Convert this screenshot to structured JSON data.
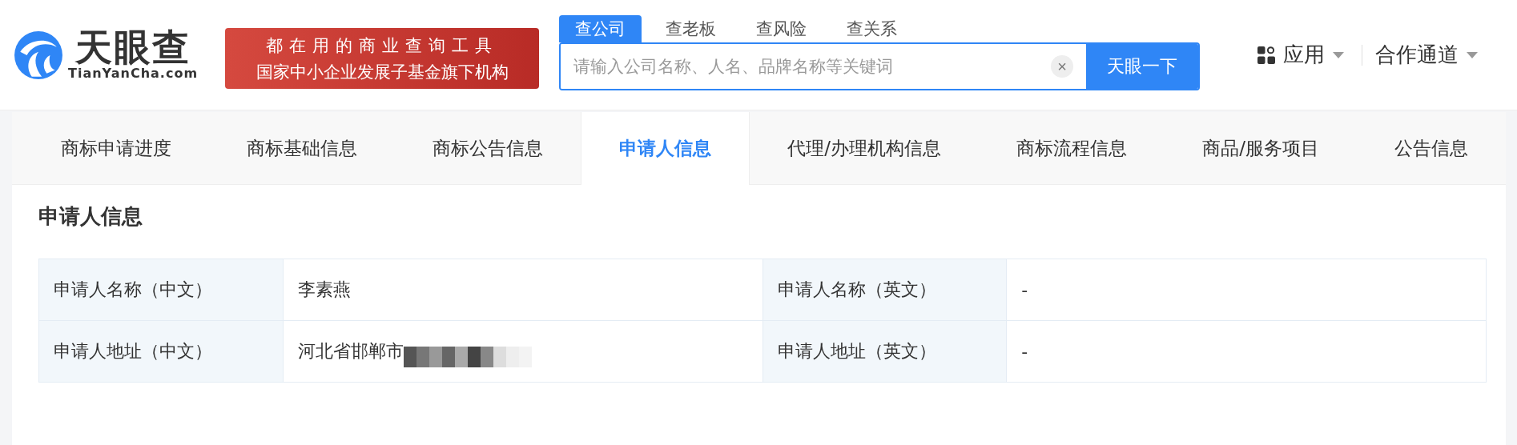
{
  "header": {
    "logo": {
      "name": "天眼查",
      "domain": "TianYanCha.com"
    },
    "slogan": [
      "都在用的商业查询工具",
      "国家中小企业发展子基金旗下机构"
    ],
    "search": {
      "tabs": [
        {
          "label": "查公司",
          "selected": true
        },
        {
          "label": "查老板",
          "selected": false
        },
        {
          "label": "查风险",
          "selected": false
        },
        {
          "label": "查关系",
          "selected": false
        }
      ],
      "placeholder": "请输入公司名称、人名、品牌名称等关键词",
      "clear": "×",
      "button": "天眼一下"
    },
    "nav": [
      {
        "label": "应用",
        "kind": "apps"
      },
      {
        "label": "合作通道",
        "kind": "plain"
      }
    ]
  },
  "tabs": [
    {
      "label": "商标申请进度",
      "selected": false
    },
    {
      "label": "商标基础信息",
      "selected": false
    },
    {
      "label": "商标公告信息",
      "selected": false
    },
    {
      "label": "申请人信息",
      "selected": true
    },
    {
      "label": "代理/办理机构信息",
      "selected": false
    },
    {
      "label": "商标流程信息",
      "selected": false
    },
    {
      "label": "商品/服务项目",
      "selected": false
    },
    {
      "label": "公告信息",
      "selected": false
    }
  ],
  "section": {
    "title": "申请人信息",
    "rows": [
      {
        "label_1": "申请人名称（中文）",
        "value_1": "李素燕",
        "redacted": false,
        "label_2": "申请人名称（英文）",
        "value_2": "-"
      },
      {
        "label_1": "申请人地址（中文）",
        "value_1": "河北省邯郸市",
        "redacted": true,
        "label_2": "申请人地址（英文）",
        "value_2": "-"
      }
    ]
  }
}
